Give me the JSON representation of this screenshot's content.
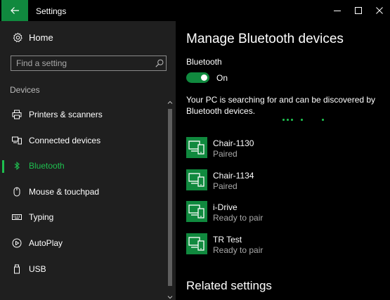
{
  "window": {
    "title": "Settings",
    "back_icon": "back-arrow-icon",
    "accent_color": "#10893e",
    "controls": [
      "minimize-icon",
      "maximize-icon",
      "close-icon"
    ]
  },
  "sidebar": {
    "home_label": "Home",
    "home_icon": "gear-icon",
    "search_placeholder": "Find a setting",
    "search_icon": "search-icon",
    "section_title": "Devices",
    "items": [
      {
        "label": "Printers & scanners",
        "icon": "printer-icon",
        "active": false
      },
      {
        "label": "Connected devices",
        "icon": "connected-devices-icon",
        "active": false
      },
      {
        "label": "Bluetooth",
        "icon": "bluetooth-icon",
        "active": true
      },
      {
        "label": "Mouse & touchpad",
        "icon": "mouse-icon",
        "active": false
      },
      {
        "label": "Typing",
        "icon": "keyboard-icon",
        "active": false
      },
      {
        "label": "AutoPlay",
        "icon": "autoplay-icon",
        "active": false
      },
      {
        "label": "USB",
        "icon": "usb-icon",
        "active": false
      }
    ],
    "active_color": "#1ebf4f"
  },
  "main": {
    "title": "Manage Bluetooth devices",
    "bluetooth_label": "Bluetooth",
    "toggle_state": "On",
    "toggle_on": true,
    "search_message": "Your PC is searching for and can be discovered by Bluetooth devices.",
    "devices": [
      {
        "name": "Chair-1130",
        "status": "Paired",
        "icon": "device-phone-icon"
      },
      {
        "name": "Chair-1134",
        "status": "Paired",
        "icon": "device-phone-icon"
      },
      {
        "name": "i-Drive",
        "status": "Ready to pair",
        "icon": "device-phone-icon"
      },
      {
        "name": "TR Test",
        "status": "Ready to pair",
        "icon": "device-phone-icon"
      }
    ],
    "related_title": "Related settings"
  }
}
